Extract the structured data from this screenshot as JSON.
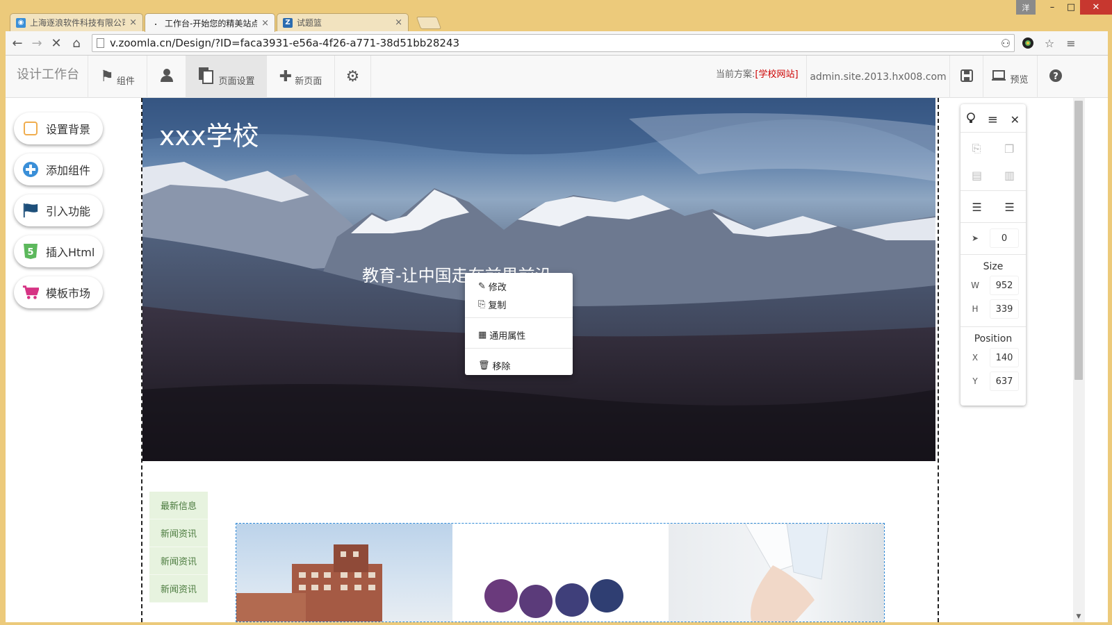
{
  "browser": {
    "tabs": [
      {
        "title": "上海逐浪软件科技有限公司",
        "active": false
      },
      {
        "title": "工作台-开始您的精美站点",
        "active": true
      },
      {
        "title": "试题篮",
        "active": false
      }
    ],
    "window": {
      "ime": "洋",
      "minimize": "–",
      "maximize": "□",
      "close": "✕"
    },
    "url": "v.zoomla.cn/Design/?ID=faca3931-e56a-4f26-a771-38d51bb28243"
  },
  "toolbar": {
    "brand": "设计工作台",
    "components_label": "组件",
    "page_settings_label": "页面设置",
    "new_page_label": "新页面",
    "scheme_prefix": "当前方案:",
    "scheme_name": "[学校网站]",
    "domain": "admin.site.2013.hx008.com",
    "preview_label": "预览"
  },
  "left_panel": {
    "items": [
      {
        "label": "设置背景",
        "icon": "square-outline-icon"
      },
      {
        "label": "添加组件",
        "icon": "plus-circle-icon"
      },
      {
        "label": "引入功能",
        "icon": "flag-icon"
      },
      {
        "label": "插入Html",
        "icon": "html5-icon"
      },
      {
        "label": "模板市场",
        "icon": "cart-icon"
      }
    ]
  },
  "hero": {
    "title": "xxx学校",
    "subtitle": "教育-让中国走在前界前沿。"
  },
  "context_menu": {
    "edit": "修改",
    "copy": "复制",
    "common_props": "通用属性",
    "remove": "移除"
  },
  "news_list": {
    "items": [
      "最新信息",
      "新闻资讯",
      "新闻资讯",
      "新闻资讯"
    ]
  },
  "right_panel": {
    "layer_value": "0",
    "size_label": "Size",
    "w_label": "W",
    "w_value": "952",
    "h_label": "H",
    "h_value": "339",
    "position_label": "Position",
    "x_label": "X",
    "x_value": "140",
    "y_label": "Y",
    "y_value": "637"
  },
  "colors": {
    "browser_frame": "#ecca7b",
    "scheme_highlight": "#cc0000",
    "news_bg": "#e7f3df",
    "gallery_border": "#2e89d6"
  }
}
